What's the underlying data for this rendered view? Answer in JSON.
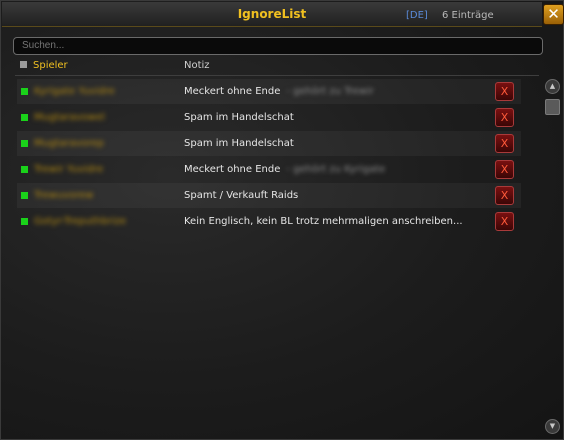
{
  "window": {
    "title": "IgnoreList",
    "realm_tag": "[DE]",
    "entry_count": "6 Einträge",
    "close_label": "✕"
  },
  "search": {
    "placeholder": "Suchen..."
  },
  "table": {
    "col_player": "Spieler",
    "col_note": "Notiz",
    "rows": [
      {
        "name": "Kyrigate Yuvidre",
        "note": "Meckert ohne Ende",
        "note_extra": "- gehört zu Trewir",
        "delete_label": "X"
      },
      {
        "name": "Mugtaravowel",
        "note": "Spam im Handelschat",
        "note_extra": "",
        "delete_label": "X"
      },
      {
        "name": "Mugtaravorep",
        "note": "Spam im Handelschat",
        "note_extra": "",
        "delete_label": "X"
      },
      {
        "name": "Trewir Yuvidre",
        "note": "Meckert ohne Ende",
        "note_extra": "- gehört zu Kyrigate",
        "delete_label": "X"
      },
      {
        "name": "Trewuvorew",
        "note": "Spamt / Verkauft Raids",
        "note_extra": "",
        "delete_label": "X"
      },
      {
        "name": "Gotyr-Treputhbrize",
        "note": "Kein Englisch, kein BL trotz mehrmaligen anschreiben...",
        "note_extra": "",
        "delete_label": "X"
      }
    ]
  },
  "scrollbar": {
    "up_icon": "▲",
    "down_icon": "▼"
  },
  "colors": {
    "accent_gold": "#f0c020",
    "online_green": "#1ad21a",
    "delete_red": "#7a1010"
  }
}
